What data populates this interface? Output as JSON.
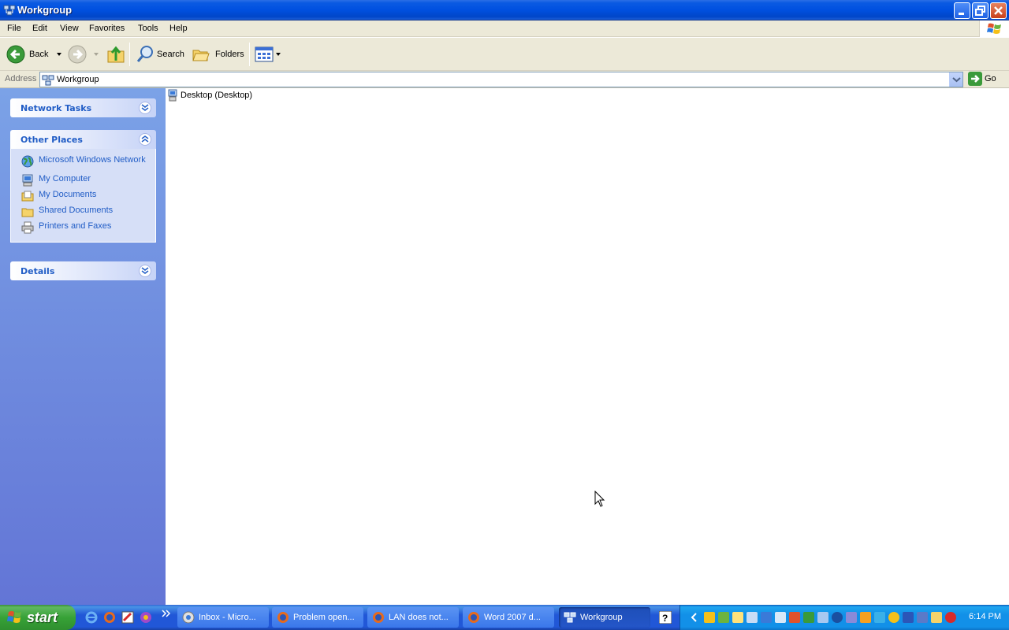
{
  "window": {
    "title": "Workgroup"
  },
  "menubar": {
    "items": [
      "File",
      "Edit",
      "View",
      "Favorites",
      "Tools",
      "Help"
    ]
  },
  "toolbar": {
    "back_label": "Back",
    "search_label": "Search",
    "folders_label": "Folders"
  },
  "address": {
    "label": "Address",
    "value": "Workgroup",
    "go_label": "Go"
  },
  "taskpane": {
    "network_tasks": {
      "title": "Network Tasks"
    },
    "other_places": {
      "title": "Other Places",
      "links": [
        {
          "label": "Microsoft Windows Network",
          "icon": "network-globe-icon"
        },
        {
          "label": "My Computer",
          "icon": "my-computer-icon"
        },
        {
          "label": "My Documents",
          "icon": "my-documents-icon"
        },
        {
          "label": "Shared Documents",
          "icon": "shared-folder-icon"
        },
        {
          "label": "Printers and Faxes",
          "icon": "printer-icon"
        }
      ]
    },
    "details": {
      "title": "Details"
    }
  },
  "content": {
    "items": [
      {
        "label": "Desktop (Desktop)",
        "icon": "computer-icon"
      }
    ]
  },
  "taskbar": {
    "start_label": "start",
    "tasks": [
      {
        "label": "Inbox - Micro...",
        "active": false
      },
      {
        "label": "Problem open...",
        "active": false
      },
      {
        "label": "LAN does not...",
        "active": false
      },
      {
        "label": "Word 2007 d...",
        "active": false
      },
      {
        "label": "Workgroup",
        "active": true
      }
    ],
    "clock": "6:14 PM"
  },
  "colors": {
    "titlebar": "#0050e0",
    "taskpane_link": "#215dc6",
    "taskbar": "#2157d7",
    "start_green": "#37a237"
  }
}
